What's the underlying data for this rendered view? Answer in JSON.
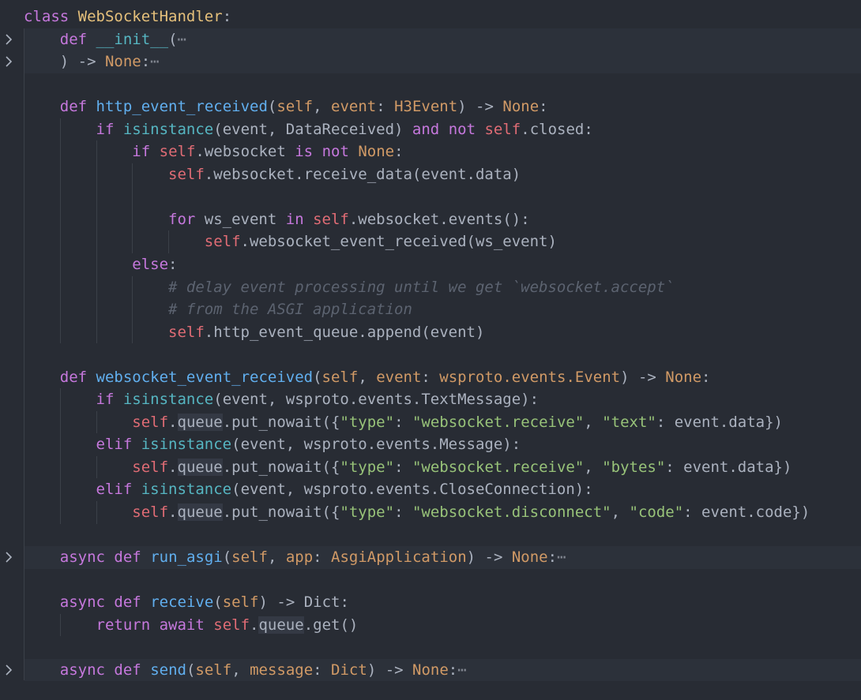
{
  "fold_icon": "chevron-right-icon",
  "lines": [
    {
      "tokens": [
        {
          "t": "class",
          "c": "keyword"
        },
        {
          "t": " ",
          "c": "text"
        },
        {
          "t": "WebSocketHandler",
          "c": "class"
        },
        {
          "t": ":",
          "c": "text"
        }
      ]
    },
    {
      "folded": true,
      "tokens": [
        {
          "t": "    ",
          "c": "text"
        },
        {
          "t": "def",
          "c": "keyword"
        },
        {
          "t": " ",
          "c": "text"
        },
        {
          "t": "__init__",
          "c": "builtin"
        },
        {
          "t": "(",
          "c": "text"
        },
        {
          "t": "⋯",
          "c": "ellipsis"
        }
      ]
    },
    {
      "folded": true,
      "tokens": [
        {
          "t": "    ) -> ",
          "c": "text"
        },
        {
          "t": "None",
          "c": "param"
        },
        {
          "t": ":",
          "c": "text"
        },
        {
          "t": "⋯",
          "c": "ellipsis"
        }
      ]
    },
    {
      "tokens": []
    },
    {
      "tokens": [
        {
          "t": "    ",
          "c": "text"
        },
        {
          "t": "def",
          "c": "keyword"
        },
        {
          "t": " ",
          "c": "text"
        },
        {
          "t": "http_event_received",
          "c": "function"
        },
        {
          "t": "(",
          "c": "text"
        },
        {
          "t": "self",
          "c": "param"
        },
        {
          "t": ", ",
          "c": "text"
        },
        {
          "t": "event",
          "c": "param"
        },
        {
          "t": ": ",
          "c": "text"
        },
        {
          "t": "H3Event",
          "c": "param"
        },
        {
          "t": ") -> ",
          "c": "text"
        },
        {
          "t": "None",
          "c": "param"
        },
        {
          "t": ":",
          "c": "text"
        }
      ]
    },
    {
      "tokens": [
        {
          "t": "        ",
          "c": "text"
        },
        {
          "t": "if",
          "c": "keyword"
        },
        {
          "t": " ",
          "c": "text"
        },
        {
          "t": "isinstance",
          "c": "builtin"
        },
        {
          "t": "(event, DataReceived) ",
          "c": "text"
        },
        {
          "t": "and",
          "c": "keyword"
        },
        {
          "t": " ",
          "c": "text"
        },
        {
          "t": "not",
          "c": "keyword"
        },
        {
          "t": " ",
          "c": "text"
        },
        {
          "t": "self",
          "c": "self"
        },
        {
          "t": ".closed:",
          "c": "text"
        }
      ]
    },
    {
      "tokens": [
        {
          "t": "            ",
          "c": "text"
        },
        {
          "t": "if",
          "c": "keyword"
        },
        {
          "t": " ",
          "c": "text"
        },
        {
          "t": "self",
          "c": "self"
        },
        {
          "t": ".websocket ",
          "c": "text"
        },
        {
          "t": "is",
          "c": "keyword"
        },
        {
          "t": " ",
          "c": "text"
        },
        {
          "t": "not",
          "c": "keyword"
        },
        {
          "t": " ",
          "c": "text"
        },
        {
          "t": "None",
          "c": "param"
        },
        {
          "t": ":",
          "c": "text"
        }
      ]
    },
    {
      "tokens": [
        {
          "t": "                ",
          "c": "text"
        },
        {
          "t": "self",
          "c": "self"
        },
        {
          "t": ".websocket.receive_data(event.data)",
          "c": "text"
        }
      ]
    },
    {
      "tokens": [
        {
          "t": "                ",
          "c": "text"
        }
      ]
    },
    {
      "tokens": [
        {
          "t": "                ",
          "c": "text"
        },
        {
          "t": "for",
          "c": "keyword"
        },
        {
          "t": " ws_event ",
          "c": "text"
        },
        {
          "t": "in",
          "c": "keyword"
        },
        {
          "t": " ",
          "c": "text"
        },
        {
          "t": "self",
          "c": "self"
        },
        {
          "t": ".websocket.events():",
          "c": "text"
        }
      ]
    },
    {
      "tokens": [
        {
          "t": "                    ",
          "c": "text"
        },
        {
          "t": "self",
          "c": "self"
        },
        {
          "t": ".websocket_event_received(ws_event)",
          "c": "text"
        }
      ]
    },
    {
      "tokens": [
        {
          "t": "            ",
          "c": "text"
        },
        {
          "t": "else",
          "c": "keyword"
        },
        {
          "t": ":",
          "c": "text"
        }
      ]
    },
    {
      "tokens": [
        {
          "t": "                ",
          "c": "text"
        },
        {
          "t": "# delay event processing until we get `websocket.accept`",
          "c": "comment"
        }
      ]
    },
    {
      "tokens": [
        {
          "t": "                ",
          "c": "text"
        },
        {
          "t": "# from the ASGI application",
          "c": "comment"
        }
      ]
    },
    {
      "tokens": [
        {
          "t": "                ",
          "c": "text"
        },
        {
          "t": "self",
          "c": "self"
        },
        {
          "t": ".http_event_queue.append(event)",
          "c": "text"
        }
      ]
    },
    {
      "tokens": []
    },
    {
      "tokens": [
        {
          "t": "    ",
          "c": "text"
        },
        {
          "t": "def",
          "c": "keyword"
        },
        {
          "t": " ",
          "c": "text"
        },
        {
          "t": "websocket_event_received",
          "c": "function"
        },
        {
          "t": "(",
          "c": "text"
        },
        {
          "t": "self",
          "c": "param"
        },
        {
          "t": ", ",
          "c": "text"
        },
        {
          "t": "event",
          "c": "param"
        },
        {
          "t": ": ",
          "c": "text"
        },
        {
          "t": "wsproto.events.Event",
          "c": "param"
        },
        {
          "t": ") -> ",
          "c": "text"
        },
        {
          "t": "None",
          "c": "param"
        },
        {
          "t": ":",
          "c": "text"
        }
      ]
    },
    {
      "tokens": [
        {
          "t": "        ",
          "c": "text"
        },
        {
          "t": "if",
          "c": "keyword"
        },
        {
          "t": " ",
          "c": "text"
        },
        {
          "t": "isinstance",
          "c": "builtin"
        },
        {
          "t": "(event, wsproto.events.TextMessage):",
          "c": "text"
        }
      ]
    },
    {
      "tokens": [
        {
          "t": "            ",
          "c": "text"
        },
        {
          "t": "self",
          "c": "self"
        },
        {
          "t": ".",
          "c": "text"
        },
        {
          "t": "queue",
          "c": "highlight"
        },
        {
          "t": ".put_nowait({",
          "c": "text"
        },
        {
          "t": "\"type\"",
          "c": "string"
        },
        {
          "t": ": ",
          "c": "text"
        },
        {
          "t": "\"websocket.receive\"",
          "c": "string"
        },
        {
          "t": ", ",
          "c": "text"
        },
        {
          "t": "\"text\"",
          "c": "string"
        },
        {
          "t": ": event.data})",
          "c": "text"
        }
      ]
    },
    {
      "tokens": [
        {
          "t": "        ",
          "c": "text"
        },
        {
          "t": "elif",
          "c": "keyword"
        },
        {
          "t": " ",
          "c": "text"
        },
        {
          "t": "isinstance",
          "c": "builtin"
        },
        {
          "t": "(event, wsproto.events.Message):",
          "c": "text"
        }
      ]
    },
    {
      "tokens": [
        {
          "t": "            ",
          "c": "text"
        },
        {
          "t": "self",
          "c": "self"
        },
        {
          "t": ".",
          "c": "text"
        },
        {
          "t": "queue",
          "c": "highlight"
        },
        {
          "t": ".put_nowait({",
          "c": "text"
        },
        {
          "t": "\"type\"",
          "c": "string"
        },
        {
          "t": ": ",
          "c": "text"
        },
        {
          "t": "\"websocket.receive\"",
          "c": "string"
        },
        {
          "t": ", ",
          "c": "text"
        },
        {
          "t": "\"bytes\"",
          "c": "string"
        },
        {
          "t": ": event.data})",
          "c": "text"
        }
      ]
    },
    {
      "tokens": [
        {
          "t": "        ",
          "c": "text"
        },
        {
          "t": "elif",
          "c": "keyword"
        },
        {
          "t": " ",
          "c": "text"
        },
        {
          "t": "isinstance",
          "c": "builtin"
        },
        {
          "t": "(event, wsproto.events.CloseConnection):",
          "c": "text"
        }
      ]
    },
    {
      "tokens": [
        {
          "t": "            ",
          "c": "text"
        },
        {
          "t": "self",
          "c": "self"
        },
        {
          "t": ".",
          "c": "text"
        },
        {
          "t": "queue",
          "c": "highlight"
        },
        {
          "t": ".put_nowait({",
          "c": "text"
        },
        {
          "t": "\"type\"",
          "c": "string"
        },
        {
          "t": ": ",
          "c": "text"
        },
        {
          "t": "\"websocket.disconnect\"",
          "c": "string"
        },
        {
          "t": ", ",
          "c": "text"
        },
        {
          "t": "\"code\"",
          "c": "string"
        },
        {
          "t": ": event.code})",
          "c": "text"
        }
      ]
    },
    {
      "tokens": []
    },
    {
      "folded": true,
      "tokens": [
        {
          "t": "    ",
          "c": "text"
        },
        {
          "t": "async",
          "c": "keyword"
        },
        {
          "t": " ",
          "c": "text"
        },
        {
          "t": "def",
          "c": "keyword"
        },
        {
          "t": " ",
          "c": "text"
        },
        {
          "t": "run_asgi",
          "c": "function"
        },
        {
          "t": "(",
          "c": "text"
        },
        {
          "t": "self",
          "c": "param"
        },
        {
          "t": ", ",
          "c": "text"
        },
        {
          "t": "app",
          "c": "param"
        },
        {
          "t": ": ",
          "c": "text"
        },
        {
          "t": "AsgiApplication",
          "c": "param"
        },
        {
          "t": ") -> ",
          "c": "text"
        },
        {
          "t": "None",
          "c": "param"
        },
        {
          "t": ":",
          "c": "text"
        },
        {
          "t": "⋯",
          "c": "ellipsis"
        }
      ]
    },
    {
      "tokens": []
    },
    {
      "tokens": [
        {
          "t": "    ",
          "c": "text"
        },
        {
          "t": "async",
          "c": "keyword"
        },
        {
          "t": " ",
          "c": "text"
        },
        {
          "t": "def",
          "c": "keyword"
        },
        {
          "t": " ",
          "c": "text"
        },
        {
          "t": "receive",
          "c": "function"
        },
        {
          "t": "(",
          "c": "text"
        },
        {
          "t": "self",
          "c": "param"
        },
        {
          "t": ") -> Dict:",
          "c": "text"
        }
      ]
    },
    {
      "tokens": [
        {
          "t": "        ",
          "c": "text"
        },
        {
          "t": "return",
          "c": "keyword"
        },
        {
          "t": " ",
          "c": "text"
        },
        {
          "t": "await",
          "c": "keyword"
        },
        {
          "t": " ",
          "c": "text"
        },
        {
          "t": "self",
          "c": "self"
        },
        {
          "t": ".",
          "c": "text"
        },
        {
          "t": "queue",
          "c": "highlight"
        },
        {
          "t": ".get()",
          "c": "text"
        }
      ]
    },
    {
      "tokens": []
    },
    {
      "folded": true,
      "tokens": [
        {
          "t": "    ",
          "c": "text"
        },
        {
          "t": "async",
          "c": "keyword"
        },
        {
          "t": " ",
          "c": "text"
        },
        {
          "t": "def",
          "c": "keyword"
        },
        {
          "t": " ",
          "c": "text"
        },
        {
          "t": "send",
          "c": "function"
        },
        {
          "t": "(",
          "c": "text"
        },
        {
          "t": "self",
          "c": "param"
        },
        {
          "t": ", ",
          "c": "text"
        },
        {
          "t": "message",
          "c": "param"
        },
        {
          "t": ": ",
          "c": "text"
        },
        {
          "t": "Dict",
          "c": "param"
        },
        {
          "t": ") -> ",
          "c": "text"
        },
        {
          "t": "None",
          "c": "param"
        },
        {
          "t": ":",
          "c": "text"
        },
        {
          "t": "⋯",
          "c": "ellipsis"
        }
      ]
    }
  ]
}
